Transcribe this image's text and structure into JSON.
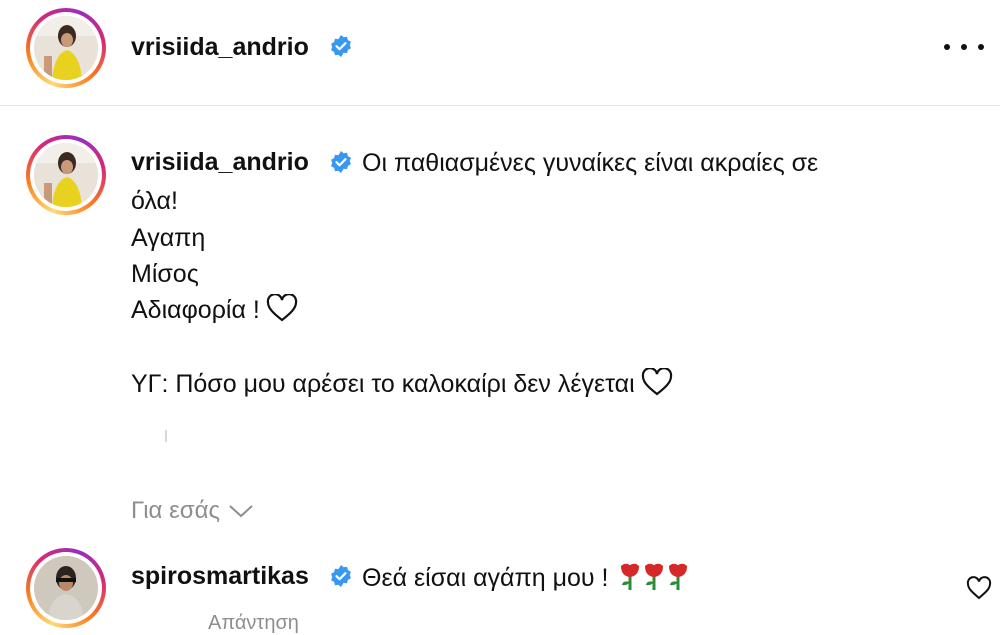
{
  "header": {
    "username": "vrisiida_andrio",
    "verified_icon": "verified-badge-icon",
    "more_icon": "more-options-icon"
  },
  "post": {
    "username": "vrisiida_andrio",
    "caption_line1": "Οι παθιασμένες γυναίκες είναι ακραίες σε",
    "caption_line2": "όλα!",
    "caption_line3": "Αγαπη",
    "caption_line4": "Μίσος",
    "caption_line5": "Αδιαφορία !",
    "caption_line6": "ΥΓ: Πόσο μου αρέσει το καλοκαίρι δεν λέγεται"
  },
  "filter": {
    "label": "Για εσάς"
  },
  "comment": {
    "username": "spirosmartikas",
    "text": "Θεά είσαι αγάπη μου !",
    "emoji": "🌹🌹🌹",
    "reply_label": "Απάντηση"
  },
  "colors": {
    "verified": "#3897f0",
    "secondary_text": "#8e8e8e",
    "rose": "#d62828"
  }
}
